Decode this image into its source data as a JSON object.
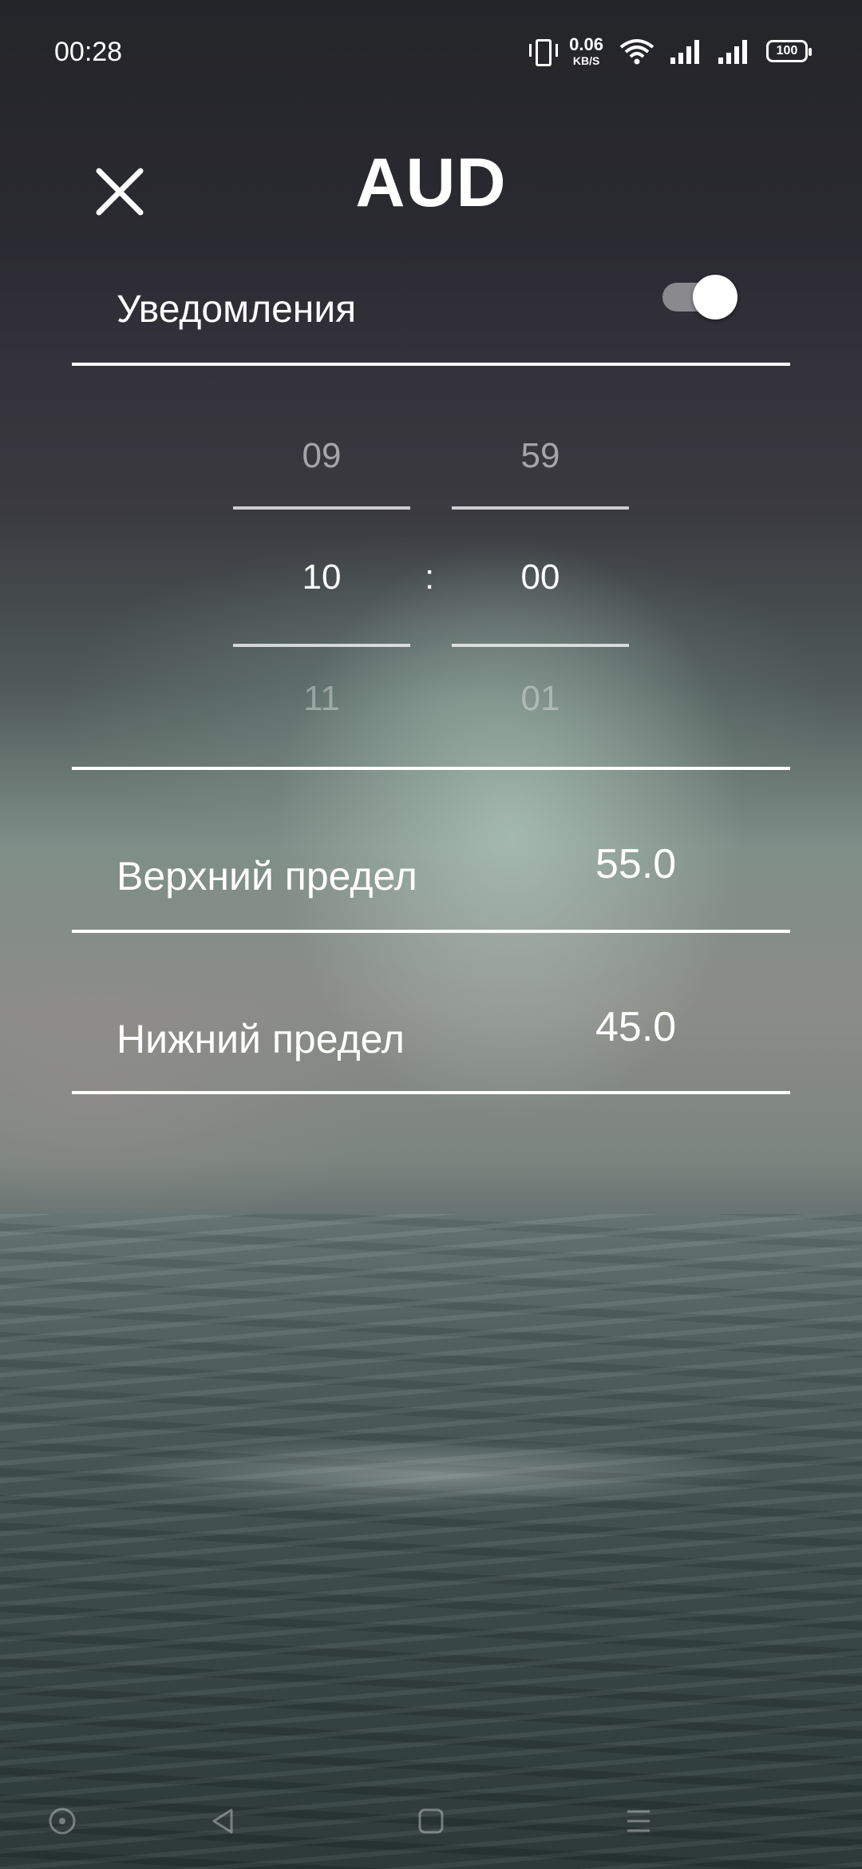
{
  "status_bar": {
    "time": "00:28",
    "net_speed_value": "0.06",
    "net_speed_unit": "KB/S",
    "battery": "100",
    "icons": [
      "vibrate-icon",
      "wifi-icon",
      "signal-icon",
      "signal-icon",
      "battery-icon"
    ]
  },
  "header": {
    "title": "AUD",
    "close_icon": "close-icon"
  },
  "notifications": {
    "label": "Уведомления",
    "enabled": true
  },
  "time_picker": {
    "hours": {
      "prev": "09",
      "selected": "10",
      "next": "11"
    },
    "separator": ":",
    "minutes": {
      "prev": "59",
      "selected": "00",
      "next": "01"
    }
  },
  "upper_limit": {
    "label": "Верхний предел",
    "value": "55.0"
  },
  "lower_limit": {
    "label": "Нижний предел",
    "value": "45.0"
  },
  "nav_bar": {
    "icons": [
      "home-circle-icon",
      "back-icon",
      "recents-icon",
      "menu-icon"
    ]
  },
  "colors": {
    "text": "#ffffff",
    "toggle_track": "#8a8a8e",
    "toggle_thumb": "#ffffff"
  }
}
